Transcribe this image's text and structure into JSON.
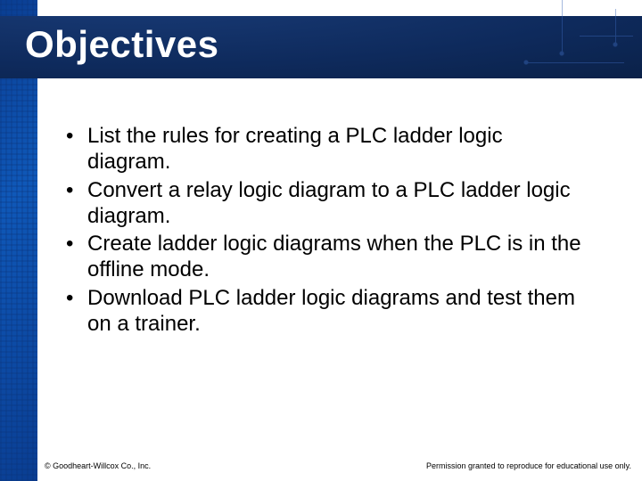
{
  "title": "Objectives",
  "bullets": [
    "List the rules for creating a PLC ladder logic diagram.",
    "Convert a relay logic diagram to a PLC ladder logic diagram.",
    "Create ladder logic diagrams when the PLC is in the offline mode.",
    "Download PLC ladder logic diagrams and test them on a trainer."
  ],
  "footer": {
    "copyright": "© Goodheart-Willcox Co., Inc.",
    "permission": "Permission granted to reproduce for educational use only."
  }
}
